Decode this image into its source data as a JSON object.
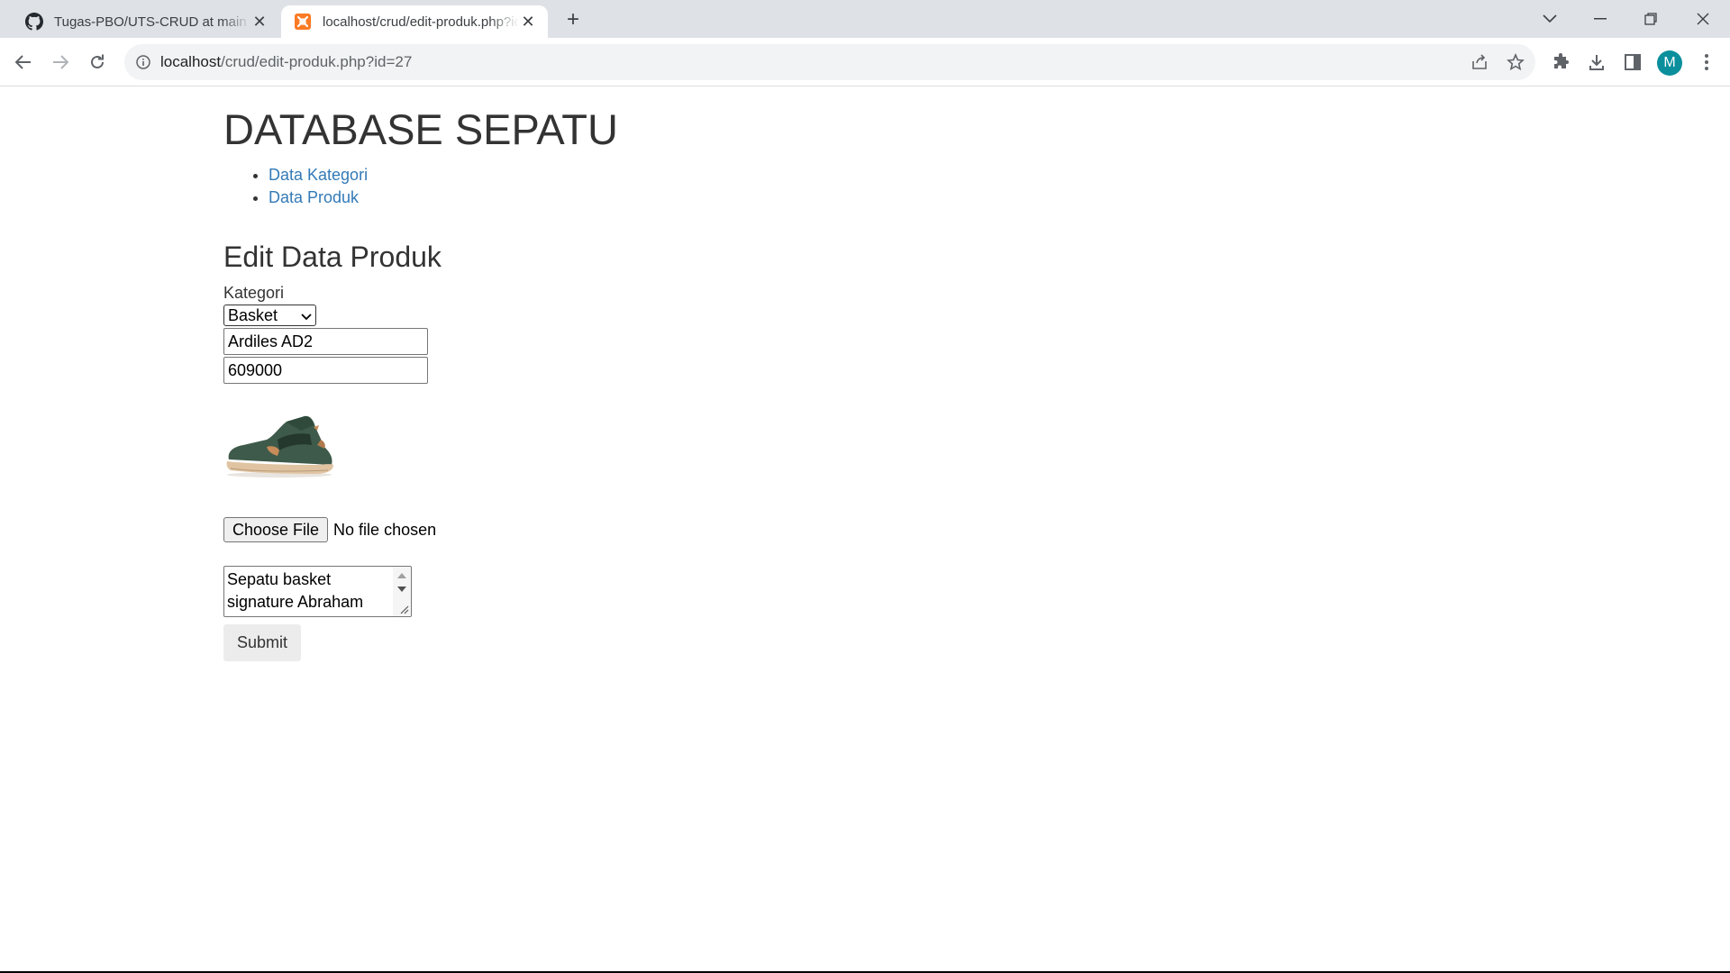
{
  "browser": {
    "tabs": [
      {
        "title": "Tugas-PBO/UTS-CRUD at main · ",
        "favicon": "github-icon",
        "active": false
      },
      {
        "title": "localhost/crud/edit-produk.php?id=27",
        "favicon": "xampp-icon",
        "active": true
      }
    ],
    "new_tab_icon": "plus-icon",
    "url": {
      "host": "localhost",
      "path": "/crud/edit-produk.php?id=27"
    },
    "avatar_letter": "M",
    "avatar_color": "#0b8f9c"
  },
  "page": {
    "site_title": "DATABASE SEPATU",
    "nav": [
      {
        "label": "Data Kategori"
      },
      {
        "label": "Data Produk"
      }
    ],
    "form_title": "Edit Data Produk",
    "kategori_label": "Kategori",
    "kategori_selected": "Basket",
    "nama_value": "Ardiles AD2",
    "harga_value": "609000",
    "product_image": "shoe-image",
    "file_button": "Choose File",
    "file_status": "No file chosen",
    "deskripsi_value": "Sepatu basket signature Abraham",
    "submit_label": "Submit"
  },
  "colors": {
    "link": "#337ab7",
    "tabbar": "#dee1e6",
    "omnibox": "#f1f3f4"
  }
}
